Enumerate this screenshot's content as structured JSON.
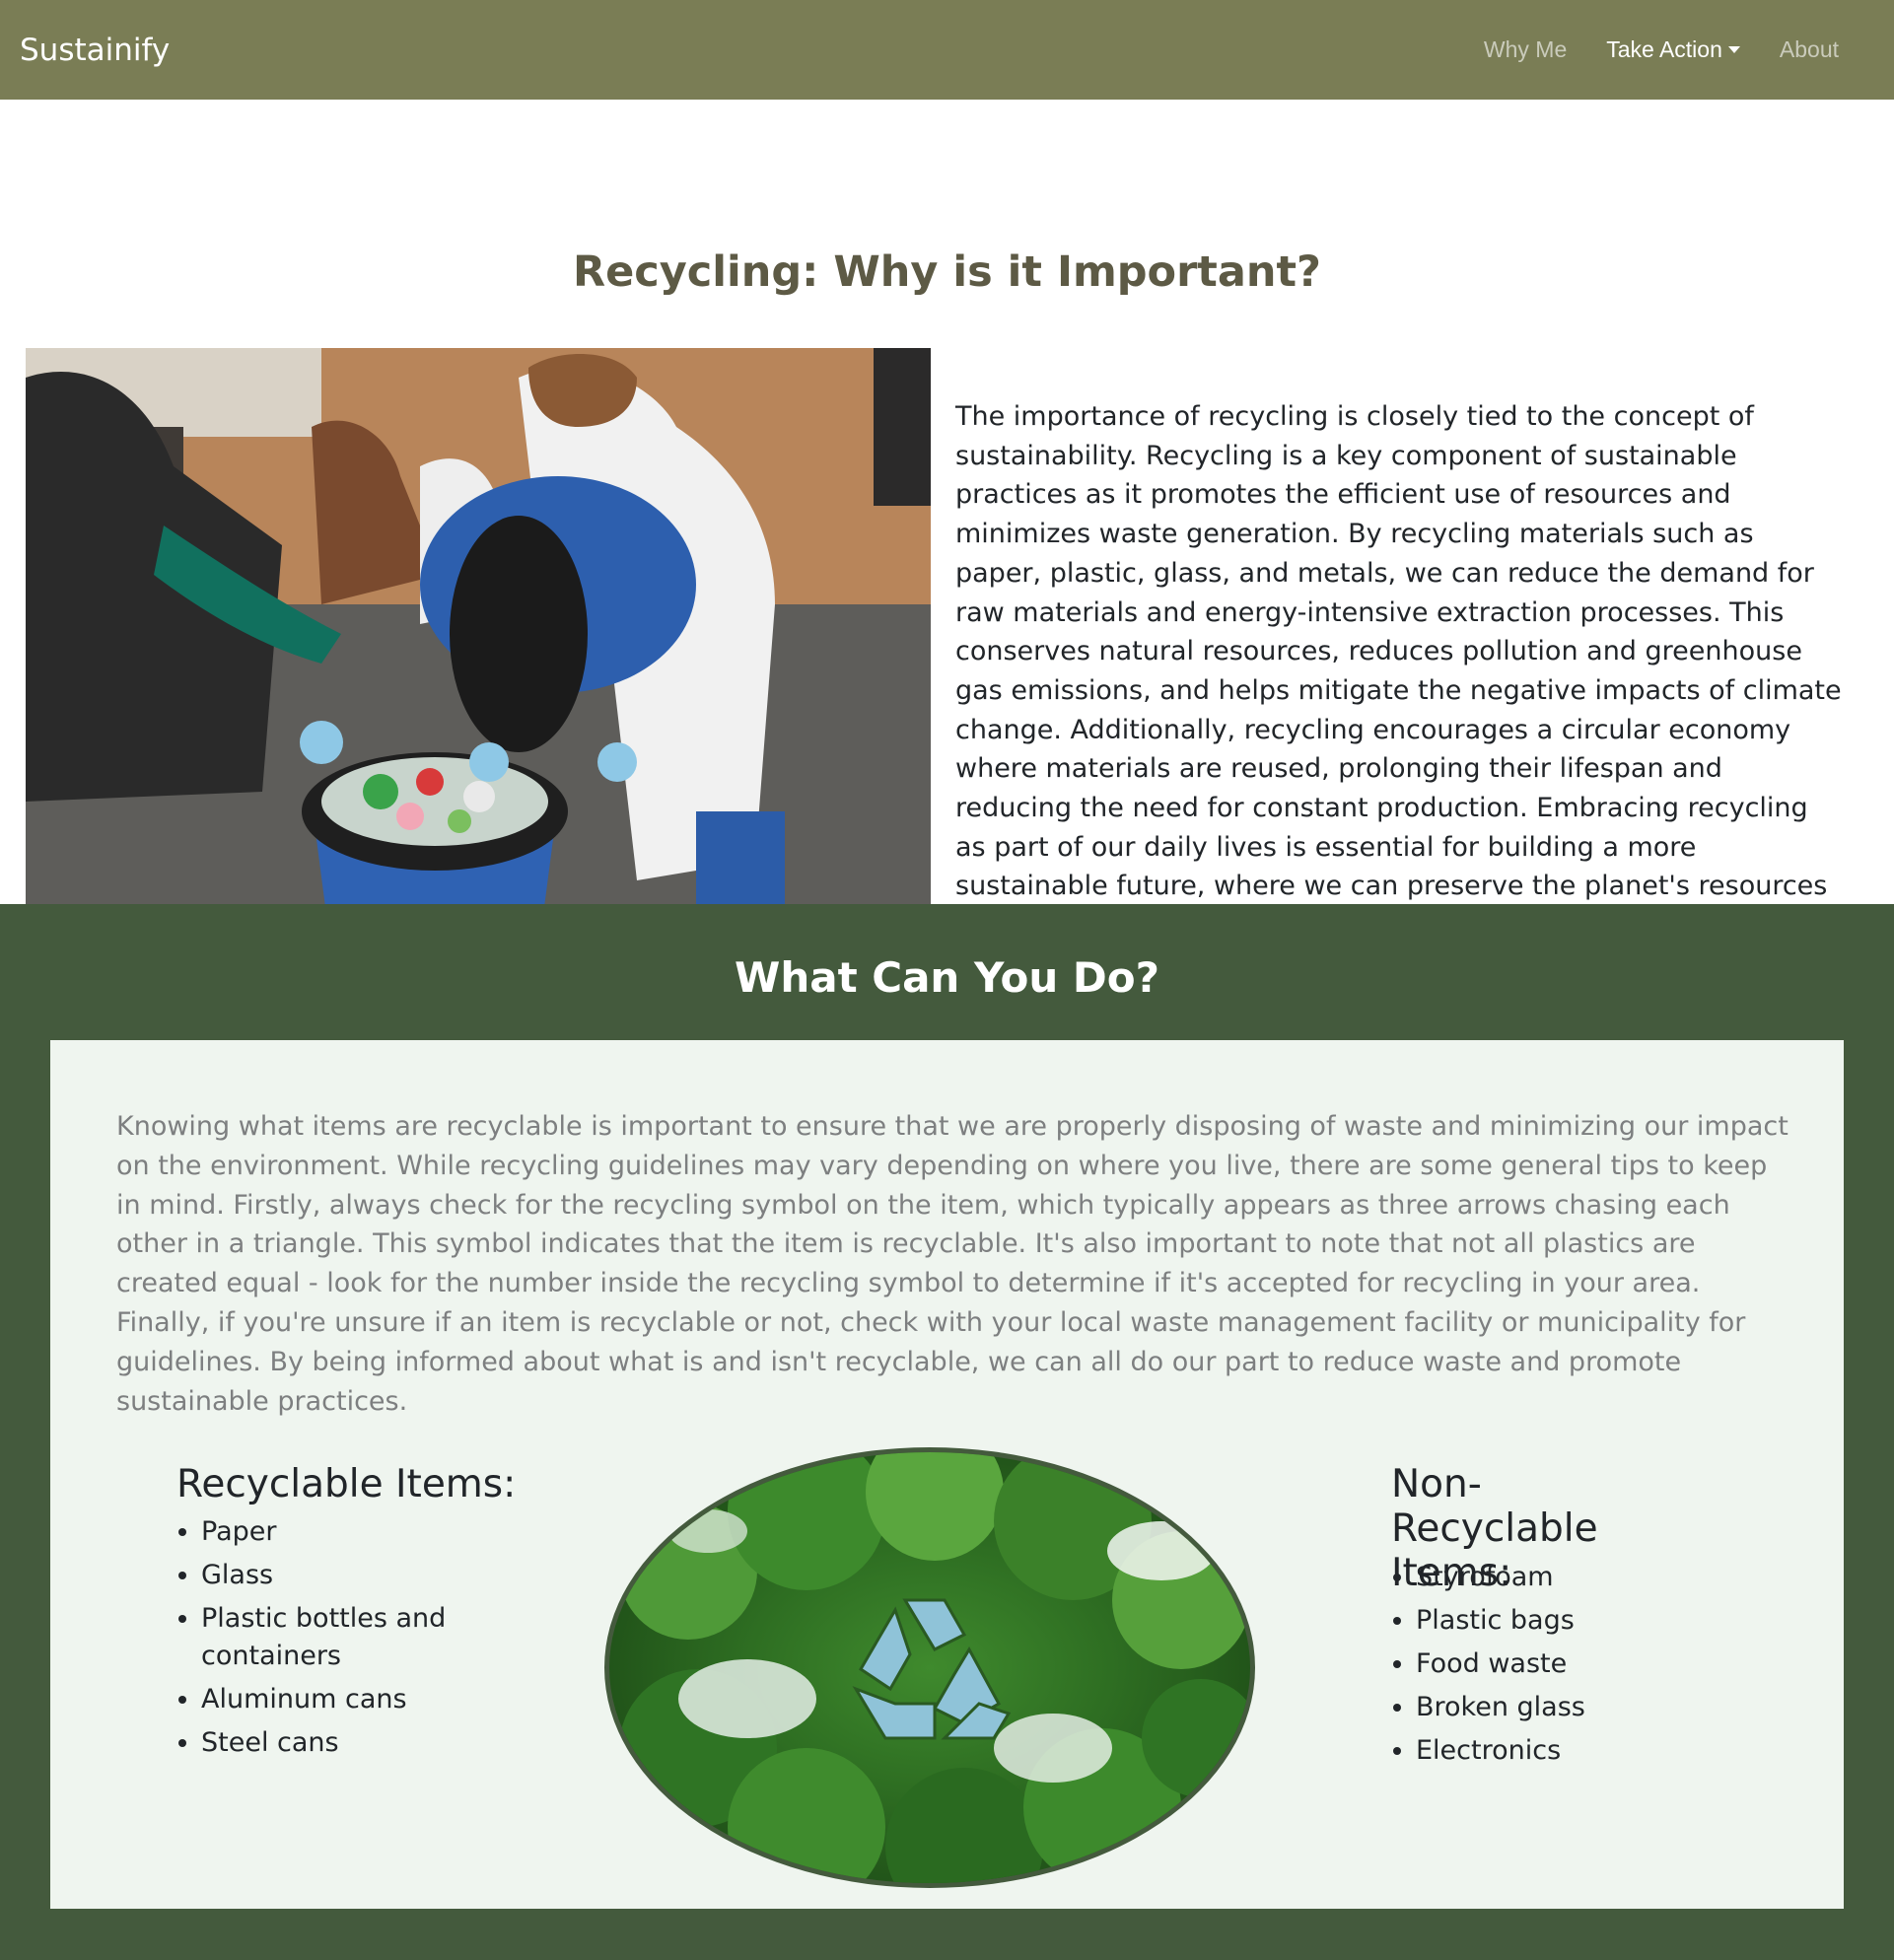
{
  "navbar": {
    "brand": "Sustainify",
    "links": [
      {
        "label": "Why Me"
      },
      {
        "label": "Take Action"
      },
      {
        "label": "About"
      }
    ]
  },
  "hero": {
    "title": "Recycling: Why is it Important?",
    "paragraph": "The importance of recycling is closely tied to the concept of sustainability. Recycling is a key component of sustainable practices as it promotes the efficient use of resources and minimizes waste generation. By recycling materials such as paper, plastic, glass, and metals, we can reduce the demand for raw materials and energy-intensive extraction processes. This conserves natural resources, reduces pollution and greenhouse gas emissions, and helps mitigate the negative impacts of climate change. Additionally, recycling encourages a circular economy where materials are reused, prolonging their lifespan and reducing the need for constant production. Embracing recycling as part of our daily lives is essential for building a more sustainable future, where we can preserve the planet's resources for generations to come."
  },
  "action": {
    "title": "What Can You Do?",
    "paragraph": "Knowing what items are recyclable is important to ensure that we are properly disposing of waste and minimizing our impact on the environment. While recycling guidelines may vary depending on where you live, there are some general tips to keep in mind. Firstly, always check for the recycling symbol on the item, which typically appears as three arrows chasing each other in a triangle. This symbol indicates that the item is recyclable. It's also important to note that not all plastics are created equal - look for the number inside the recycling symbol to determine if it's accepted for recycling in your area. Finally, if you're unsure if an item is recyclable or not, check with your local waste management facility or municipality for guidelines. By being informed about what is and isn't recyclable, we can all do our part to reduce waste and promote sustainable practices.",
    "recyclable": {
      "heading": "Recyclable Items:",
      "items": [
        "Paper",
        "Glass",
        "Plastic bottles and containers",
        "Aluminum cans",
        "Steel cans"
      ]
    },
    "non_recyclable": {
      "heading": "Non-Recyclable Items:",
      "items": [
        "Styrofoam",
        "Plastic bags",
        "Food waste",
        "Broken glass",
        "Electronics"
      ]
    }
  },
  "colors": {
    "navbar": "#7a7d55",
    "section_bg": "#445a3d",
    "card_bg": "#eff5ef",
    "title_brown": "#5d5a45"
  },
  "icons": {
    "dropdown": "chevron-down-icon",
    "recycle": "recycle-icon"
  }
}
